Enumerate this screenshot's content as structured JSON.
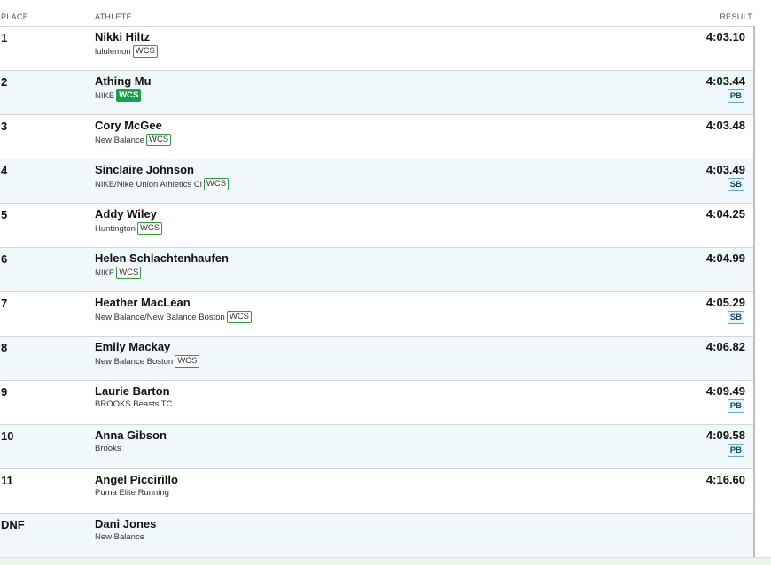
{
  "header": {
    "place": "PLACE",
    "athlete": "ATHLETE",
    "result": "RESULT"
  },
  "rows": [
    {
      "place": "1",
      "name": "Nikki Hiltz",
      "team": "lululemon",
      "badge": "WCS",
      "badge_style": "outline",
      "result": "4:03.10",
      "record": ""
    },
    {
      "place": "2",
      "name": "Athing Mu",
      "team": "NIKE",
      "badge": "WCS",
      "badge_style": "filled",
      "result": "4:03.44",
      "record": "PB"
    },
    {
      "place": "3",
      "name": "Cory McGee",
      "team": "New Balance",
      "badge": "WCS",
      "badge_style": "outline",
      "result": "4:03.48",
      "record": ""
    },
    {
      "place": "4",
      "name": "Sinclaire Johnson",
      "team": "NIKE/Nike Union Athletics Cl",
      "badge": "WCS",
      "badge_style": "outline",
      "result": "4:03.49",
      "record": "SB"
    },
    {
      "place": "5",
      "name": "Addy Wiley",
      "team": "Huntington",
      "badge": "WCS",
      "badge_style": "outline",
      "result": "4:04.25",
      "record": ""
    },
    {
      "place": "6",
      "name": "Helen Schlachtenhaufen",
      "team": "NIKE",
      "badge": "WCS",
      "badge_style": "outline",
      "result": "4:04.99",
      "record": ""
    },
    {
      "place": "7",
      "name": "Heather MacLean",
      "team": "New Balance/New Balance Boston",
      "badge": "WCS",
      "badge_style": "outline",
      "result": "4:05.29",
      "record": "SB"
    },
    {
      "place": "8",
      "name": "Emily Mackay",
      "team": "New Balance Boston",
      "badge": "WCS",
      "badge_style": "outline",
      "result": "4:06.82",
      "record": ""
    },
    {
      "place": "9",
      "name": "Laurie Barton",
      "team": "BROOKS Beasts TC",
      "badge": "",
      "badge_style": "",
      "result": "4:09.49",
      "record": "PB"
    },
    {
      "place": "10",
      "name": "Anna Gibson",
      "team": "Brooks",
      "badge": "",
      "badge_style": "",
      "result": "4:09.58",
      "record": "PB"
    },
    {
      "place": "11",
      "name": "Angel Piccirillo",
      "team": "Puma Elite Running",
      "badge": "",
      "badge_style": "",
      "result": "4:16.60",
      "record": ""
    },
    {
      "place": "DNF",
      "name": "Dani Jones",
      "team": "New Balance",
      "badge": "",
      "badge_style": "",
      "result": "",
      "record": ""
    }
  ],
  "colors": {
    "row_alt_bg": "#f0f8fc",
    "badge_border": "#2d9c3c",
    "badge_filled_bg": "#16a34a",
    "record_text": "#0e4d6e"
  }
}
